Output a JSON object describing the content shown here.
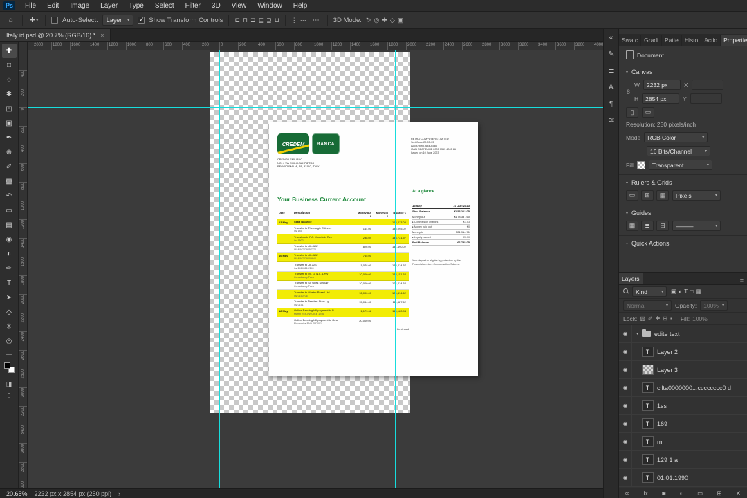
{
  "menubar": {
    "logo": "Ps",
    "items": [
      "File",
      "Edit",
      "Image",
      "Layer",
      "Type",
      "Select",
      "Filter",
      "3D",
      "View",
      "Window",
      "Help"
    ]
  },
  "options": {
    "home_icon": "⌂",
    "tool_icon": "✚",
    "caret": "▾",
    "auto_select_label": "Auto-Select:",
    "target_value": "Layer",
    "transform_label": "Show Transform Controls",
    "more_icon": "⋯",
    "mode_label": "3D Mode:",
    "align_icons": [
      {
        "name": "align-left-icon",
        "glyph": "⊏"
      },
      {
        "name": "align-center-h-icon",
        "glyph": "⊓"
      },
      {
        "name": "align-right-icon",
        "glyph": "⊐"
      },
      {
        "name": "align-top-icon",
        "glyph": "⊑"
      },
      {
        "name": "align-middle-icon",
        "glyph": "⊒"
      },
      {
        "name": "align-bottom-icon",
        "glyph": "⊔"
      }
    ],
    "distribute_icons": [
      {
        "name": "distribute-vertical-icon",
        "glyph": "⋮"
      },
      {
        "name": "distribute-horizontal-icon",
        "glyph": "⋯"
      }
    ],
    "mode_icons": [
      {
        "name": "3d-rotate-icon",
        "glyph": "↻"
      },
      {
        "name": "3d-roll-icon",
        "glyph": "◎"
      },
      {
        "name": "3d-drag-icon",
        "glyph": "✚"
      },
      {
        "name": "3d-slide-icon",
        "glyph": "◇"
      },
      {
        "name": "3d-scale-icon",
        "glyph": "▣"
      }
    ]
  },
  "tabbar": {
    "title": "Italy id.psd @ 20.7% (RGB/16) *",
    "close": "×"
  },
  "rulers": {
    "horizontal": [
      "2000",
      "1800",
      "1600",
      "1400",
      "1200",
      "1000",
      "800",
      "600",
      "400",
      "200",
      "0",
      "200",
      "400",
      "600",
      "800",
      "1000",
      "1200",
      "1400",
      "1600",
      "1800",
      "2000",
      "2200",
      "2400",
      "2600",
      "2800",
      "3000",
      "3200",
      "3400",
      "3600",
      "3800",
      "4000"
    ],
    "vertical": [
      "400",
      "200",
      "0",
      "200",
      "400",
      "600",
      "800",
      "1000",
      "1200",
      "1400",
      "1600",
      "1800",
      "2000",
      "2200",
      "2400",
      "2600",
      "2800",
      "3000",
      "3200",
      "3400",
      "3600",
      "3800",
      "4000"
    ]
  },
  "toolbar": {
    "tools": [
      {
        "name": "move-tool",
        "glyph": "✚",
        "cls": "active"
      },
      {
        "name": "marquee-tool",
        "glyph": "□"
      },
      {
        "name": "lasso-tool",
        "glyph": "◌"
      },
      {
        "name": "quick-selection-tool",
        "glyph": "✱"
      },
      {
        "name": "crop-tool",
        "glyph": "◰"
      },
      {
        "name": "frame-tool",
        "glyph": "▣"
      },
      {
        "name": "eyedropper-tool",
        "glyph": "✒"
      },
      {
        "name": "healing-brush-tool",
        "glyph": "⊕"
      },
      {
        "name": "brush-tool",
        "glyph": "✐"
      },
      {
        "name": "clone-stamp-tool",
        "glyph": "▩"
      },
      {
        "name": "history-brush-tool",
        "glyph": "↶"
      },
      {
        "name": "eraser-tool",
        "glyph": "▭"
      },
      {
        "name": "gradient-tool",
        "glyph": "▤"
      },
      {
        "name": "blur-tool",
        "glyph": "◉"
      },
      {
        "name": "dodge-tool",
        "glyph": "◐"
      },
      {
        "name": "pen-tool",
        "glyph": "✑"
      },
      {
        "name": "type-tool",
        "glyph": "T"
      },
      {
        "name": "path-selection-tool",
        "glyph": "➤"
      },
      {
        "name": "shape-tool",
        "glyph": "◇"
      },
      {
        "name": "hand-tool",
        "glyph": "✳"
      },
      {
        "name": "zoom-tool",
        "glyph": "◎"
      }
    ],
    "more_icon": "⋯",
    "mask_icon": "◨",
    "screen_icon": "▯"
  },
  "dock": {
    "icons": [
      {
        "name": "collapse-dock-icon",
        "glyph": "«"
      },
      {
        "name": "brush-settings-panel-icon",
        "glyph": "✎"
      },
      {
        "name": "clone-source-panel-icon",
        "glyph": "≣"
      },
      {
        "name": "character-panel-icon",
        "glyph": "A"
      },
      {
        "name": "paragraph-panel-icon",
        "glyph": "¶"
      },
      {
        "name": "libraries-panel-icon",
        "glyph": "≋"
      }
    ]
  },
  "panels": {
    "tabs": [
      "Swatc",
      "Gradi",
      "Patte",
      "Histo",
      "Actio"
    ],
    "properties_tab": "Properties",
    "menu_icon": "≡",
    "properties": {
      "doc_label": "Document",
      "canvas_section": "Canvas",
      "w_label": "W",
      "w_value": "2232 px",
      "x_label": "X",
      "h_label": "H",
      "h_value": "2854 px",
      "y_label": "Y",
      "link_icon": "8",
      "res_text": "Resolution: 250 pixels/inch",
      "mode_label": "Mode",
      "mode_value": "RGB Color",
      "depth_value": "16 Bits/Channel",
      "fill_label": "Fill",
      "fill_value": "Transparent",
      "rulers_section": "Rulers & Grids",
      "units_value": "Pixels",
      "guides_section": "Guides",
      "guide_style_value": "———",
      "quick_section": "Quick Actions",
      "ruler_icons": [
        {
          "name": "ruler-toggle-icon",
          "glyph": "▭"
        },
        {
          "name": "grid-toggle-icon",
          "glyph": "⊞"
        },
        {
          "name": "snap-toggle-icon",
          "glyph": "▦"
        }
      ],
      "guide_icons": [
        {
          "name": "add-guide-icon",
          "glyph": "▦"
        },
        {
          "name": "guide-layout-icon",
          "glyph": "≣"
        },
        {
          "name": "clear-guides-icon",
          "glyph": "⊟"
        }
      ]
    },
    "layers": {
      "tab": "Layers",
      "filter_label": "Kind",
      "filter_icons": [
        {
          "name": "filter-pixel-layers-icon",
          "glyph": "▣"
        },
        {
          "name": "filter-adjustment-layers-icon",
          "glyph": "◐"
        },
        {
          "name": "filter-type-layers-icon",
          "glyph": "T"
        },
        {
          "name": "filter-shape-layers-icon",
          "glyph": "□"
        },
        {
          "name": "filter-smart-objects-icon",
          "glyph": "▦"
        }
      ],
      "blend_value": "Normal",
      "opacity_label": "Opacity:",
      "opacity_value": "100%",
      "lock_label": "Lock:",
      "lock_icons": [
        {
          "name": "lock-transparent-icon",
          "glyph": "▨"
        },
        {
          "name": "lock-pixels-icon",
          "glyph": "✐"
        },
        {
          "name": "lock-position-icon",
          "glyph": "✚"
        },
        {
          "name": "lock-artboard-icon",
          "glyph": "⊞"
        },
        {
          "name": "lock-all-icon",
          "glyph": "▪"
        }
      ],
      "fill_label": "Fill:",
      "fill_value": "100%",
      "items": [
        {
          "cls": "group",
          "label": "edite text"
        },
        {
          "cls": "text",
          "label": "Layer 2"
        },
        {
          "cls": "raster",
          "label": "Layer 3"
        },
        {
          "cls": "text",
          "label": "cilta0000000...cccccccc0 d"
        },
        {
          "cls": "text",
          "label": "1ss"
        },
        {
          "cls": "text",
          "label": "169"
        },
        {
          "cls": "text",
          "label": "m"
        },
        {
          "cls": "text",
          "label": "129 1 a"
        },
        {
          "cls": "text",
          "label": "01.01.1990"
        }
      ],
      "actions": [
        {
          "name": "link-layers-icon",
          "glyph": "∞"
        },
        {
          "name": "layer-effects-icon",
          "glyph": "fx"
        },
        {
          "name": "add-mask-icon",
          "glyph": "◙"
        },
        {
          "name": "adjustment-layer-icon",
          "glyph": "◐"
        },
        {
          "name": "new-group-icon",
          "glyph": "▭"
        },
        {
          "name": "new-layer-icon",
          "glyph": "⊞"
        },
        {
          "name": "delete-layer-icon",
          "glyph": "✕"
        }
      ]
    }
  },
  "statusbar": {
    "zoom": "20.65%",
    "doc_info": "2232 px x 2854 px (250 ppi)",
    "chevron": "›"
  },
  "statement": {
    "bank": {
      "logo_left": "CREDEM",
      "logo_right": "BANCA",
      "address": [
        "CREDITO EMILIANO",
        "NO. 4 VIA EMILIA SANPIETRO",
        "REGGIO EMILIA, RE, 42110, ITALY"
      ]
    },
    "recipient": [
      "RETRO COMPUTERS LIMITED",
      "Sort Code 20-05-03",
      "Account no. 63404586",
      "IBAN GB07 EUHB 2005 0363 4045 86",
      "Issued on 10 June 2023"
    ],
    "title": "Your Business Current Account",
    "glance": {
      "heading": "At a glance",
      "period": {
        "from": "13 May",
        "to": "10 Jun 2023"
      },
      "rows": [
        {
          "label": "Start Balance",
          "value": "€153,213.05",
          "cls": "strong"
        },
        {
          "label": "Money out",
          "value": "€178,337.60"
        },
        {
          "label": "▸ Commission charges",
          "value": "€1.53",
          "cls": "sub"
        },
        {
          "label": "▸ Money paid out",
          "value": "€0",
          "cls": "sub"
        },
        {
          "label": "Money in",
          "value": "€21,914.71"
        },
        {
          "label": "▸ Loyalty reward",
          "value": "€0.70",
          "cls": "sub"
        },
        {
          "label": "End Balance",
          "value": "€6,755.05",
          "cls": "strong"
        }
      ],
      "note": "Your deposit is eligible by protection by the Financial services Compensation Scheme"
    },
    "table": {
      "headers": [
        "Date",
        "Description",
        "Money out €",
        "Money in €",
        "Balance €"
      ],
      "rows": [
        {
          "date": "13 May",
          "desc": "Start Balance",
          "sub": "",
          "out": "",
          "inn": "",
          "bal": "153,213.05",
          "cls": "hl start"
        },
        {
          "date": "",
          "desc": "Transfer to The magic Citizens",
          "sub": "inv 145",
          "out": "144.00",
          "inn": "",
          "bal": "145,095.02"
        },
        {
          "date": "",
          "desc": "Transfers to F.A. Moorfield Rec",
          "sub": "inv 1502",
          "out": "238.04",
          "inn": "",
          "bal": "143,731.57",
          "cls": "hl"
        },
        {
          "date": "",
          "desc": "Transfer to UL-AKZ",
          "sub": "UL A/A 7479457774",
          "out": "826.00",
          "inn": "",
          "bal": "141,490.02"
        },
        {
          "date": "16 May",
          "desc": "Transfer to UL-AKZ",
          "sub": "UL A/A 7479209842",
          "out": "745.00",
          "inn": "",
          "bal": "",
          "cls": "hl"
        },
        {
          "date": "",
          "desc": "Transfer to UL A/S",
          "sub": "inv 24145212/249",
          "out": "1,078.00",
          "inn": "",
          "bal": "133,414.57"
        },
        {
          "date": "",
          "desc": "Transfer to Mr. G. N.L. Levy",
          "sub": "Consultancy Fees",
          "out": "10,000.00",
          "inn": "",
          "bal": "132,151.62",
          "cls": "hl"
        },
        {
          "date": "",
          "desc": "Transfer to Sir Giles Sinclair",
          "sub": "Consultancy Fees",
          "out": "10,000.00",
          "inn": "",
          "bal": "124,414.62"
        },
        {
          "date": "",
          "desc": "Transfer to Master Resell Ltd",
          "sub": "inv 0150706",
          "out": "12,000.00",
          "inn": "",
          "bal": "120,414.62",
          "cls": "hl"
        },
        {
          "date": "",
          "desc": "Transfer to Teacher Stars Lg",
          "sub": "inv 0151",
          "out": "15,054.40",
          "inn": "",
          "bal": "111,327.62"
        },
        {
          "date": "18 May",
          "desc": "Online Banking bill payment to B",
          "sub": "Martin REF-INVOICE 1246",
          "out": "1,179.68",
          "inn": "",
          "bal": "110,180.94",
          "cls": "hl"
        },
        {
          "date": "",
          "desc": "Online Banking bill payment to Gma",
          "sub": "Electronics RNA-R87001",
          "out": "20,000.00",
          "inn": "",
          "bal": ""
        }
      ],
      "continued": "Continued"
    }
  }
}
